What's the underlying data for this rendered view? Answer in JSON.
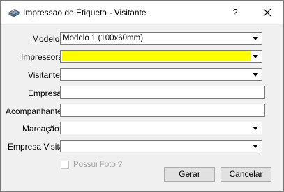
{
  "window": {
    "title": "Impressao de Etiqueta - Visitante",
    "help_glyph": "?",
    "close_glyph": "✕",
    "icon": "printer-icon"
  },
  "form": {
    "modelo": {
      "label": "Modelo:",
      "value": "Modelo 1 (100x60mm)"
    },
    "impressora": {
      "label": "Impressora",
      "value": "",
      "highlight": "#ffff00"
    },
    "visitante": {
      "label": "Visitante:",
      "value": ""
    },
    "empresa": {
      "label": "Empresa:",
      "value": ""
    },
    "acompanhante": {
      "label": "Acompanhante:",
      "value": ""
    },
    "marcacao": {
      "label": "Marcação:",
      "value": ""
    },
    "empresa_visita": {
      "label": "Empresa Visita",
      "value": ""
    },
    "possui_foto": {
      "label": "Possui Foto ?",
      "checked": false,
      "enabled": false
    }
  },
  "buttons": {
    "gerar": "Gerar",
    "cancelar": "Cancelar"
  }
}
